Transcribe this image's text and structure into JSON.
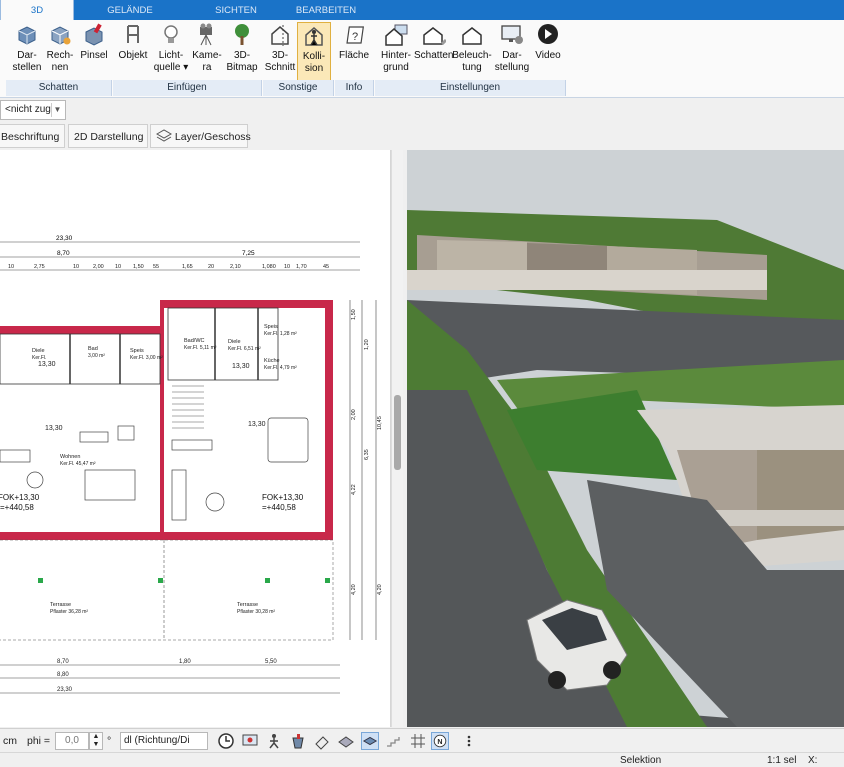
{
  "ribbon_tabs": [
    {
      "label": "3D",
      "active": true
    },
    {
      "label": "GELÄNDE",
      "active": false
    },
    {
      "label": "SICHTEN",
      "active": false
    },
    {
      "label": "BEARBEITEN",
      "active": false
    }
  ],
  "ribbon_buttons": [
    {
      "line1": "Dar-",
      "line2": "stellen",
      "icon": "cube-display-icon"
    },
    {
      "line1": "Rech-",
      "line2": "nen",
      "icon": "cube-render-icon"
    },
    {
      "line1": "Pinsel",
      "line2": "",
      "icon": "paint-cube-icon"
    },
    {
      "line1": "Objekt",
      "line2": "",
      "icon": "chair-icon"
    },
    {
      "line1": "Licht-",
      "line2": "quelle ▾",
      "icon": "bulb-icon"
    },
    {
      "line1": "Kame-",
      "line2": "ra",
      "icon": "camera-icon"
    },
    {
      "line1": "3D-",
      "line2": "Bitmap",
      "icon": "tree-icon"
    },
    {
      "line1": "3D-",
      "line2": "Schnitt",
      "icon": "section-icon"
    },
    {
      "line1": "Kolli-",
      "line2": "sion",
      "icon": "collision-icon",
      "selected": true
    },
    {
      "line1": "Fläche",
      "line2": "",
      "icon": "area-question-icon"
    },
    {
      "line1": "Hinter-",
      "line2": "grund",
      "icon": "house-background-icon"
    },
    {
      "line1": "Schatten",
      "line2": "",
      "icon": "house-shadow-icon"
    },
    {
      "line1": "Beleuch-",
      "line2": "tung",
      "icon": "house-lighting-icon"
    },
    {
      "line1": "Dar-",
      "line2": "stellung",
      "icon": "monitor-gear-icon"
    },
    {
      "line1": "Video",
      "line2": "",
      "icon": "play-icon"
    }
  ],
  "ribbon_groups": [
    "Schatten",
    "Einfügen",
    "Sonstige",
    "Info",
    "Einstellungen"
  ],
  "filter_select": {
    "value": "<nicht zug"
  },
  "toolbar2": [
    {
      "label": "Beschriftung",
      "icon": "label-icon"
    },
    {
      "label": "2D Darstellung",
      "icon": ""
    },
    {
      "label": "Layer/Geschoss",
      "icon": "layers-icon"
    }
  ],
  "plan": {
    "dims_top": [
      "23,30",
      "8,70",
      "7,25"
    ],
    "dims_top_row": [
      "10",
      "2,75",
      "10",
      "2,00",
      "10",
      "1,50",
      "55",
      "1,65",
      "20",
      "2,10",
      "1,080",
      "10",
      "1,70",
      "45"
    ],
    "dims_bottom": [
      "8,70",
      "1,80",
      "5,50",
      "8,80",
      "23,30"
    ],
    "dims_right": [
      "1,50",
      "1,20",
      "2,00",
      "10,45",
      "6,35",
      "4,22",
      "4,20",
      "4,20"
    ],
    "rooms_left": [
      {
        "name": "Diele",
        "area": "Ker.Fl."
      },
      {
        "name": "Bad",
        "area": "3,00 m²"
      },
      {
        "name": "Speis",
        "area": "Ker.Fl. 3,00 m²"
      },
      {
        "name": "Wohnen",
        "area": "Ker.Fl. 45,47 m²"
      },
      {
        "name": "Terrasse",
        "area": "Pflaster 36,28 m²"
      }
    ],
    "rooms_right": [
      {
        "name": "Bad/WC",
        "area": "Ker.Fl. 5,11 m²"
      },
      {
        "name": "Diele",
        "area": "Ker.Fl. 6,51 m²"
      },
      {
        "name": "Speis",
        "area": "Ker.Fl. 1,28 m²"
      },
      {
        "name": "Küche",
        "area": "Ker.Fl. 4,79 m²"
      },
      {
        "name": "Terrasse",
        "area": "Pflaster 30,28 m²"
      }
    ],
    "level_marks": [
      "13,30",
      "13,30",
      "13,30",
      "13,30"
    ],
    "fok_left": "FOK+13,30",
    "fok_left_2": "=+440,58",
    "fok_right": "FOK+13,30",
    "fok_right_2": "=+440,58"
  },
  "bottombar": {
    "unit": "cm",
    "phi_label": "phi =",
    "phi_value": "0,0",
    "degree": "°",
    "direction_select": "dl (Richtung/Di"
  },
  "bottom_icons": [
    "clock-icon",
    "screen-icon",
    "walk-icon",
    "bucket-icon",
    "eraser-icon",
    "hatch-icon",
    "layer-icon",
    "stairs-icon",
    "grid-icon",
    "north-icon",
    "more-icon"
  ],
  "status": {
    "mode": "Selektion",
    "scale": "1:1 sel",
    "coord_label": "X:"
  },
  "colors": {
    "ribbon_blue": "#1a73c8",
    "wall_red": "#c8284a",
    "selected_button": "#fbe8b8"
  }
}
